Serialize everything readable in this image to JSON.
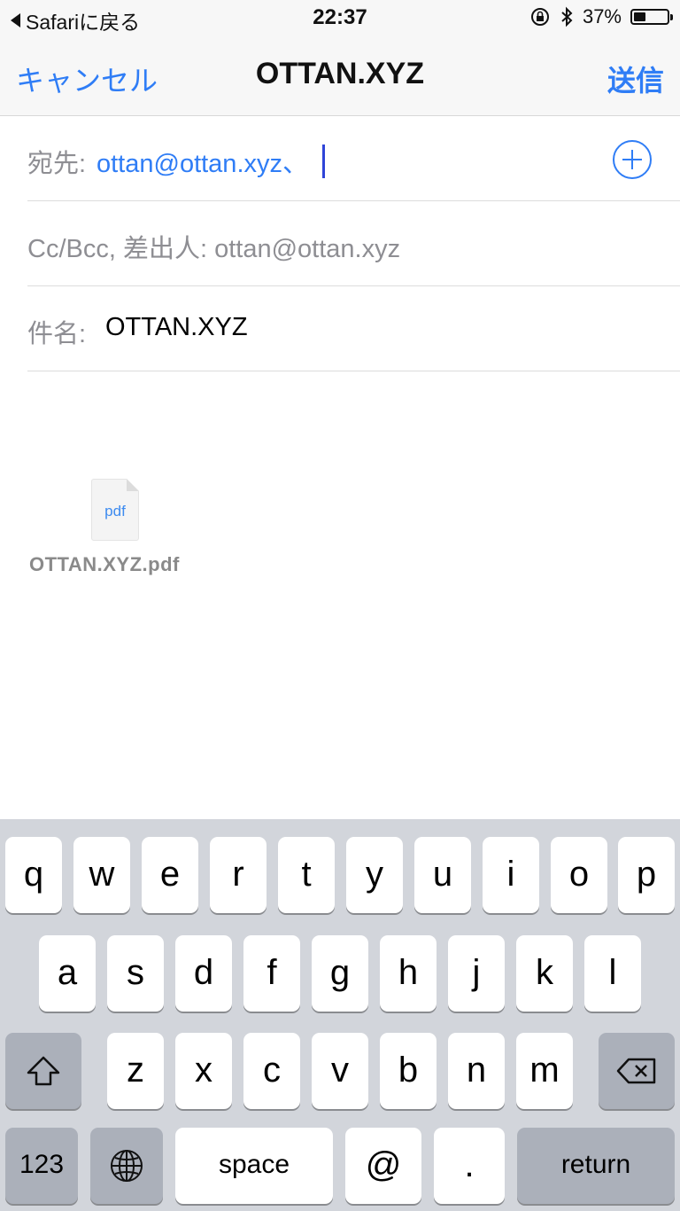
{
  "status_bar": {
    "back_label": "Safariに戻る",
    "time": "22:37",
    "battery_percent_label": "37%",
    "battery_level": 0.37
  },
  "nav": {
    "cancel_label": "キャンセル",
    "title": "OTTAN.XYZ",
    "send_label": "送信"
  },
  "fields": {
    "to_label": "宛先:",
    "to_value": "ottan@ottan.xyz、",
    "cc_label": "Cc/Bcc, 差出人: ottan@ottan.xyz",
    "subject_label": "件名:",
    "subject_value": "OTTAN.XYZ"
  },
  "attachment": {
    "icon_text": "pdf",
    "file_name": "OTTAN.XYZ.pdf"
  },
  "keyboard": {
    "row1": [
      "q",
      "w",
      "e",
      "r",
      "t",
      "y",
      "u",
      "i",
      "o",
      "p"
    ],
    "row2": [
      "a",
      "s",
      "d",
      "f",
      "g",
      "h",
      "j",
      "k",
      "l"
    ],
    "row3": [
      "z",
      "x",
      "c",
      "v",
      "b",
      "n",
      "m"
    ],
    "numbers_label": "123",
    "space_label": "space",
    "at_label": "@",
    "dot_label": ".",
    "return_label": "return"
  },
  "colors": {
    "accent": "#2f7df6",
    "keyboard_bg": "#d2d5db",
    "dark_key": "#abb0ba"
  }
}
